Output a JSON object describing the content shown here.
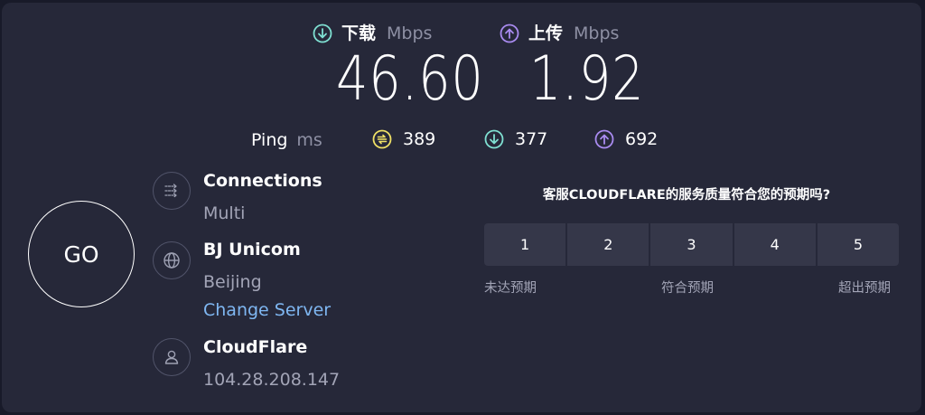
{
  "download": {
    "label": "下载",
    "unit": "Mbps",
    "value": "46.60",
    "icon": "arrow-down-circle-icon",
    "color": "#7fe0d2"
  },
  "upload": {
    "label": "上传",
    "unit": "Mbps",
    "value": "1.92",
    "icon": "arrow-up-circle-icon",
    "color": "#a98bf0"
  },
  "ping": {
    "label": "Ping",
    "unit": "ms",
    "idle": {
      "value": "389",
      "icon": "ping-idle-icon",
      "color": "#f0e166"
    },
    "download": {
      "value": "377",
      "icon": "arrow-down-circle-icon",
      "color": "#7fe0d2"
    },
    "upload": {
      "value": "692",
      "icon": "arrow-up-circle-icon",
      "color": "#a98bf0"
    }
  },
  "go_button": {
    "label": "GO"
  },
  "connections": {
    "title": "Connections",
    "value": "Multi",
    "icon": "connections-icon"
  },
  "server": {
    "title": "BJ Unicom",
    "location": "Beijing",
    "change_link": "Change Server",
    "icon": "globe-icon"
  },
  "provider": {
    "title": "CloudFlare",
    "ip": "104.28.208.147",
    "icon": "user-icon"
  },
  "survey": {
    "question": "客服CLOUDFLARE的服务质量符合您的预期吗?",
    "options": [
      "1",
      "2",
      "3",
      "4",
      "5"
    ],
    "captions": {
      "low": "未达预期",
      "mid": "符合预期",
      "high": "超出预期"
    }
  },
  "colors": {
    "background": "#262839",
    "rating_button": "#353749",
    "link": "#7fb7f2"
  }
}
